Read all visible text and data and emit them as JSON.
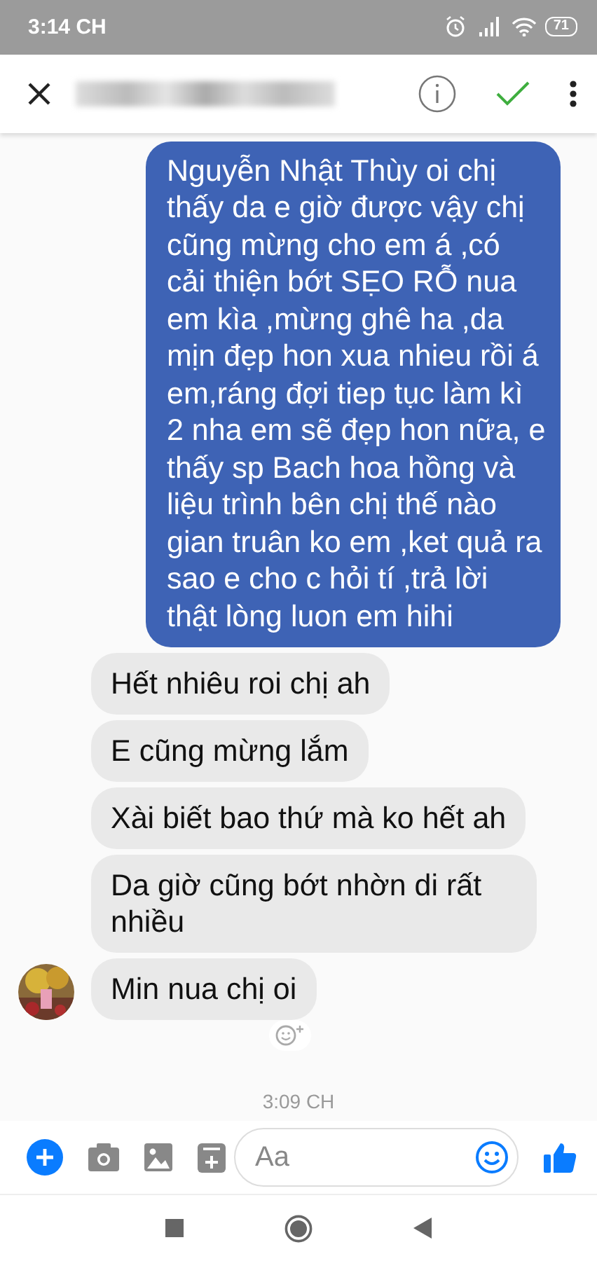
{
  "status_bar": {
    "time": "3:14 CH",
    "battery": "71"
  },
  "messages": [
    {
      "kind": "sent",
      "text": "Nguyễn Nhật Thùy oi chị thấy da e giờ được vậy chị cũng mừng cho em á ,có cải thiện bớt SẸO RỖ nua em kìa ,mừng ghê ha ,da mịn đẹp hon xua nhieu rồi á em,ráng đợi tiep tục làm kì 2 nha em sẽ đẹp hon nữa, e thấy sp Bach hoa hồng và liệu trình bên chị thế nào gian truân ko em ,ket quả ra sao e cho c hỏi tí ,trả lời thật lòng luon em hihi"
    },
    {
      "kind": "received",
      "text": "Hết nhiêu roi chị ah"
    },
    {
      "kind": "received",
      "text": "E cũng mừng lắm"
    },
    {
      "kind": "received",
      "text": "Xài biết bao thứ mà ko hết ah"
    },
    {
      "kind": "received",
      "text": "Da giờ cũng bớt nhờn di rất nhiều"
    },
    {
      "kind": "received_last",
      "text": "Min nua chị oi"
    }
  ],
  "timestamp": "3:09 CH",
  "composer": {
    "placeholder": "Aa"
  }
}
